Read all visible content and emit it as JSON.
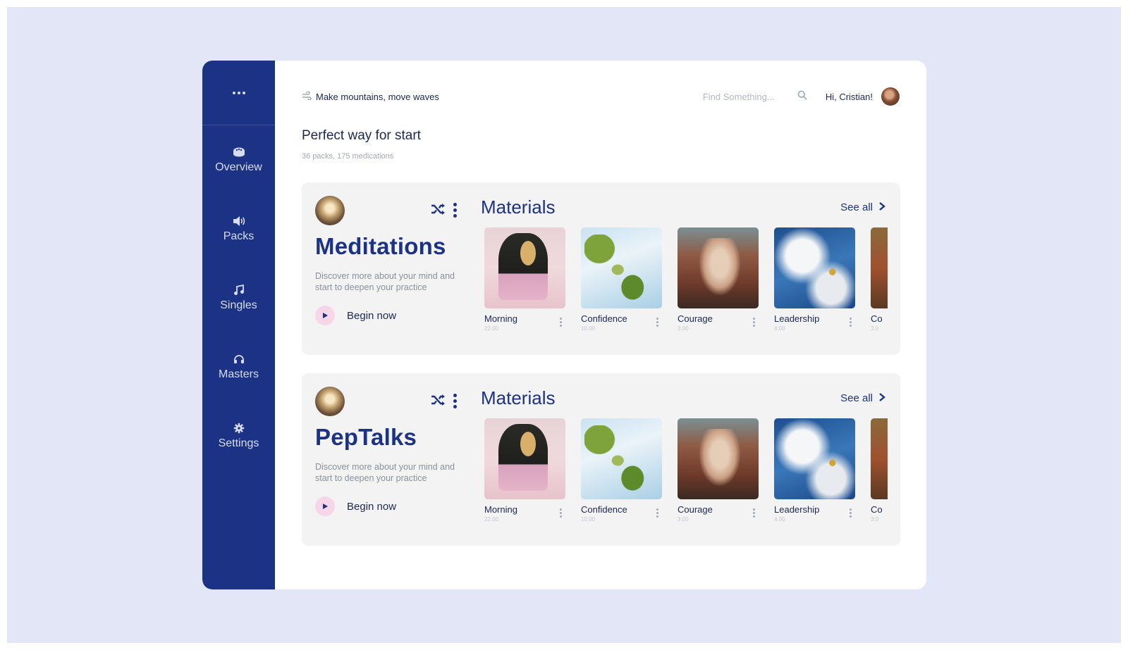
{
  "sidebar": {
    "menu_icon": "more-horizontal-icon",
    "items": [
      {
        "label": "Overview",
        "icon": "dashboard-icon"
      },
      {
        "label": "Packs",
        "icon": "speaker-icon"
      },
      {
        "label": "Singles",
        "icon": "music-note-icon"
      },
      {
        "label": "Masters",
        "icon": "headphones-icon"
      },
      {
        "label": "Settings",
        "icon": "gear-icon"
      }
    ]
  },
  "header": {
    "motto": "Make mountains, move waves",
    "search_placeholder": "Find Something...",
    "greeting": "Hi, Cristian!"
  },
  "page": {
    "title": "Perfect way for start",
    "subtitle": "36 packs, 175 medications"
  },
  "sections": [
    {
      "title": "Meditations",
      "description": "Discover more about your mind and start to deepen your practice",
      "begin_label": "Begin now",
      "materials_title": "Materials",
      "see_all": "See all",
      "cards": [
        {
          "title": "Morning",
          "duration": "22.00"
        },
        {
          "title": "Confidence",
          "duration": "10.00"
        },
        {
          "title": "Courage",
          "duration": "3.00"
        },
        {
          "title": "Leadership",
          "duration": "4.00"
        },
        {
          "title": "Co",
          "duration": "3.0"
        }
      ]
    },
    {
      "title": "PepTalks",
      "description": "Discover more about your mind and start to deepen your practice",
      "begin_label": "Begin now",
      "materials_title": "Materials",
      "see_all": "See all",
      "cards": [
        {
          "title": "Morning",
          "duration": "22.00"
        },
        {
          "title": "Confidence",
          "duration": "10.00"
        },
        {
          "title": "Courage",
          "duration": "3.00"
        },
        {
          "title": "Leadership",
          "duration": "4.00"
        },
        {
          "title": "Co",
          "duration": "3.0"
        }
      ]
    }
  ],
  "colors": {
    "primary": "#1b3285",
    "background": "#e2e6f7",
    "card_bg": "#f3f3f4",
    "play_bg": "#f7d6ea"
  }
}
